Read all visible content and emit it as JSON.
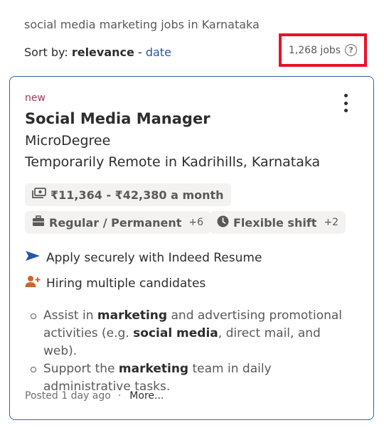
{
  "search": {
    "query_text": "social media marketing jobs in Karnataka",
    "sort_prefix": "Sort by:",
    "sort_active": "relevance",
    "sort_separator": "-",
    "sort_alt": "date",
    "job_count": "1,268 jobs",
    "help_glyph": "?"
  },
  "job": {
    "new_label": "new",
    "title": "Social Media Manager",
    "company": "MicroDegree",
    "location": "Temporarily Remote in Kadrihills, Karnataka",
    "salary": "₹11,364 - ₹42,380 a month",
    "job_type": "Regular / Permanent",
    "job_type_more": "+6",
    "shift": "Flexible shift",
    "shift_more": "+2",
    "feature_apply": "Apply securely with Indeed Resume",
    "feature_hiring": "Hiring multiple candidates",
    "bullets": [
      [
        "Assist in ",
        "marketing",
        " and advertising promotional activities (e.g. ",
        "social media",
        ", direct mail, and web)."
      ],
      [
        "Support the ",
        "marketing",
        " team in daily administrative tasks."
      ]
    ],
    "posted": "Posted 1 day ago",
    "footer_dot": "·",
    "more_link": "More..."
  },
  "colors": {
    "highlight_box": "#e8112a",
    "link_blue": "#2557a7",
    "new_label": "#a0375a",
    "card_border": "#3b5fb0",
    "hiring_icon": "#c9672e"
  },
  "icons": {
    "salary": "money-icon",
    "job_type": "briefcase-icon",
    "shift": "clock-icon",
    "apply": "send-arrow-icon",
    "hiring": "add-person-icon",
    "menu": "more-vertical-icon",
    "help": "help-circle-icon"
  }
}
